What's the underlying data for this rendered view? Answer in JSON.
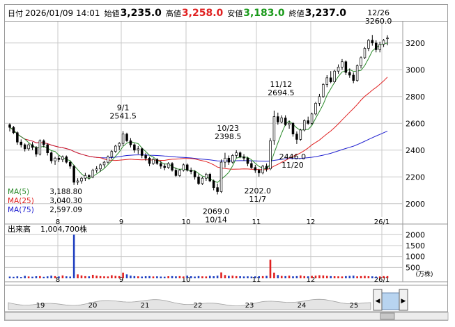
{
  "header": {
    "date_label": "日付",
    "datetime": "2026/01/09 14:01",
    "open_label": "始値",
    "open": "3,235.0",
    "high_label": "高値",
    "high": "3,258.0",
    "low_label": "安値",
    "low": "3,183.0",
    "close_label": "終値",
    "close": "3,237.0"
  },
  "colors": {
    "up": "#ffffff",
    "down": "#000000",
    "ma5": "#2a8a2a",
    "ma25": "#e02020",
    "ma75": "#2020d0",
    "vol_red": "#e02020",
    "vol_blue": "#2040c0",
    "grid": "#c8c8c8",
    "high_text": "#e02020",
    "low_text": "#1a9a1a"
  },
  "chart_data": [
    {
      "type": "candlestick",
      "x_ticks": [
        "8",
        "9",
        "10",
        "11",
        "12",
        "26/1"
      ],
      "y_ticks": [
        2000,
        2200,
        2400,
        2600,
        2800,
        3000,
        3200
      ],
      "ylim": [
        1900,
        3360
      ],
      "legend": [
        {
          "label": "MA(5)",
          "value": "3,188.80"
        },
        {
          "label": "MA(25)",
          "value": "3,040.30"
        },
        {
          "label": "MA(75)",
          "value": "2,597.09"
        }
      ],
      "annotations": [
        {
          "date": "9/1",
          "value": "2541.5",
          "kind": "high"
        },
        {
          "date": "10/14",
          "value": "2069.0",
          "kind": "low"
        },
        {
          "date": "10/23",
          "value": "2398.5",
          "kind": "high"
        },
        {
          "date": "11/12",
          "value": "2694.5",
          "kind": "high"
        },
        {
          "date": "11/7",
          "value": "2202.0",
          "kind": "low"
        },
        {
          "date": "11/20",
          "value": "2446.0",
          "kind": "low"
        },
        {
          "date": "12/26",
          "value": "3260.0",
          "kind": "high"
        }
      ],
      "candles": [
        [
          2590,
          2600,
          2540,
          2570
        ],
        [
          2570,
          2580,
          2520,
          2530
        ],
        [
          2530,
          2540,
          2440,
          2460
        ],
        [
          2460,
          2480,
          2420,
          2440
        ],
        [
          2440,
          2450,
          2390,
          2410
        ],
        [
          2410,
          2450,
          2395,
          2440
        ],
        [
          2440,
          2460,
          2400,
          2420
        ],
        [
          2420,
          2430,
          2350,
          2370
        ],
        [
          2370,
          2480,
          2360,
          2470
        ],
        [
          2470,
          2480,
          2420,
          2440
        ],
        [
          2440,
          2450,
          2360,
          2380
        ],
        [
          2380,
          2390,
          2300,
          2320
        ],
        [
          2320,
          2350,
          2290,
          2340
        ],
        [
          2340,
          2360,
          2310,
          2330
        ],
        [
          2330,
          2360,
          2310,
          2350
        ],
        [
          2350,
          2360,
          2300,
          2310
        ],
        [
          2310,
          2320,
          2260,
          2280
        ],
        [
          2280,
          2290,
          2140,
          2160
        ],
        [
          2160,
          2190,
          2140,
          2170
        ],
        [
          2170,
          2200,
          2150,
          2190
        ],
        [
          2190,
          2230,
          2170,
          2210
        ],
        [
          2210,
          2220,
          2180,
          2200
        ],
        [
          2200,
          2260,
          2190,
          2250
        ],
        [
          2250,
          2280,
          2230,
          2260
        ],
        [
          2260,
          2300,
          2240,
          2290
        ],
        [
          2290,
          2320,
          2270,
          2310
        ],
        [
          2310,
          2360,
          2300,
          2350
        ],
        [
          2350,
          2400,
          2330,
          2390
        ],
        [
          2390,
          2440,
          2380,
          2430
        ],
        [
          2430,
          2460,
          2400,
          2450
        ],
        [
          2450,
          2542,
          2430,
          2520
        ],
        [
          2520,
          2530,
          2460,
          2470
        ],
        [
          2470,
          2490,
          2420,
          2440
        ],
        [
          2440,
          2450,
          2380,
          2400
        ],
        [
          2400,
          2430,
          2370,
          2410
        ],
        [
          2410,
          2420,
          2340,
          2360
        ],
        [
          2360,
          2380,
          2320,
          2340
        ],
        [
          2340,
          2350,
          2280,
          2300
        ],
        [
          2300,
          2340,
          2290,
          2330
        ],
        [
          2330,
          2340,
          2290,
          2300
        ],
        [
          2300,
          2320,
          2260,
          2280
        ],
        [
          2280,
          2300,
          2250,
          2270
        ],
        [
          2270,
          2310,
          2260,
          2300
        ],
        [
          2300,
          2310,
          2240,
          2250
        ],
        [
          2250,
          2270,
          2200,
          2210
        ],
        [
          2210,
          2260,
          2200,
          2250
        ],
        [
          2250,
          2300,
          2240,
          2290
        ],
        [
          2290,
          2300,
          2240,
          2250
        ],
        [
          2250,
          2270,
          2220,
          2240
        ],
        [
          2240,
          2250,
          2180,
          2200
        ],
        [
          2200,
          2220,
          2140,
          2150
        ],
        [
          2150,
          2200,
          2140,
          2190
        ],
        [
          2190,
          2230,
          2170,
          2220
        ],
        [
          2220,
          2230,
          2160,
          2170
        ],
        [
          2170,
          2180,
          2100,
          2120
        ],
        [
          2120,
          2150,
          2069,
          2090
        ],
        [
          2090,
          2330,
          2080,
          2310
        ],
        [
          2310,
          2380,
          2270,
          2340
        ],
        [
          2340,
          2360,
          2290,
          2310
        ],
        [
          2310,
          2370,
          2300,
          2360
        ],
        [
          2360,
          2399,
          2340,
          2380
        ],
        [
          2380,
          2390,
          2340,
          2350
        ],
        [
          2350,
          2370,
          2320,
          2340
        ],
        [
          2340,
          2350,
          2280,
          2300
        ],
        [
          2300,
          2320,
          2260,
          2270
        ],
        [
          2270,
          2290,
          2230,
          2250
        ],
        [
          2250,
          2260,
          2202,
          2230
        ],
        [
          2230,
          2290,
          2220,
          2280
        ],
        [
          2280,
          2300,
          2240,
          2260
        ],
        [
          2260,
          2490,
          2250,
          2470
        ],
        [
          2470,
          2695,
          2440,
          2650
        ],
        [
          2650,
          2680,
          2590,
          2610
        ],
        [
          2610,
          2660,
          2600,
          2640
        ],
        [
          2640,
          2660,
          2580,
          2590
        ],
        [
          2590,
          2620,
          2560,
          2600
        ],
        [
          2600,
          2610,
          2500,
          2520
        ],
        [
          2520,
          2540,
          2446,
          2480
        ],
        [
          2480,
          2560,
          2470,
          2550
        ],
        [
          2550,
          2630,
          2540,
          2620
        ],
        [
          2620,
          2650,
          2590,
          2600
        ],
        [
          2600,
          2680,
          2590,
          2670
        ],
        [
          2670,
          2760,
          2660,
          2750
        ],
        [
          2750,
          2820,
          2730,
          2800
        ],
        [
          2800,
          2900,
          2790,
          2890
        ],
        [
          2890,
          2960,
          2870,
          2940
        ],
        [
          2940,
          2990,
          2900,
          2910
        ],
        [
          2910,
          3000,
          2900,
          2990
        ],
        [
          2990,
          3040,
          2970,
          3020
        ],
        [
          3020,
          3080,
          3000,
          3060
        ],
        [
          3060,
          3070,
          2960,
          2980
        ],
        [
          2980,
          3010,
          2940,
          2960
        ],
        [
          2960,
          2980,
          2900,
          2920
        ],
        [
          2920,
          3040,
          2910,
          3030
        ],
        [
          3030,
          3100,
          3010,
          3090
        ],
        [
          3090,
          3170,
          3080,
          3160
        ],
        [
          3160,
          3230,
          3140,
          3220
        ],
        [
          3220,
          3260,
          3180,
          3200
        ],
        [
          3200,
          3220,
          3130,
          3150
        ],
        [
          3150,
          3210,
          3130,
          3190
        ],
        [
          3190,
          3230,
          3170,
          3220
        ],
        [
          3235,
          3258,
          3183,
          3237
        ]
      ]
    },
    {
      "type": "bar",
      "title": "出来高",
      "latest": "1,004,700株",
      "unit": "(万株)",
      "y_ticks": [
        500,
        1000,
        1500,
        2000
      ],
      "ylim": [
        0,
        2200
      ],
      "values": [
        80,
        70,
        90,
        60,
        110,
        85,
        75,
        95,
        100,
        70,
        90,
        120,
        100,
        85,
        130,
        90,
        80,
        2000,
        180,
        130,
        100,
        90,
        160,
        120,
        100,
        90,
        85,
        140,
        110,
        100,
        260,
        180,
        120,
        100,
        90,
        80,
        95,
        100,
        85,
        90,
        80,
        75,
        95,
        100,
        90,
        100,
        85,
        120,
        95,
        80,
        100,
        90,
        85,
        110,
        95,
        120,
        270,
        150,
        110,
        120,
        100,
        95,
        85,
        90,
        80,
        90,
        95,
        100,
        110,
        850,
        260,
        150,
        110,
        100,
        120,
        90,
        100,
        130,
        100,
        90,
        110,
        120,
        140,
        130,
        110,
        100,
        95,
        90,
        85,
        100,
        110,
        120,
        90,
        100,
        110,
        95,
        90,
        80,
        85,
        100,
        100
      ]
    }
  ],
  "navigator": {
    "labels": [
      "19",
      "20",
      "21",
      "22",
      "23",
      "24",
      "25"
    ],
    "left_arrow": "◀",
    "right_arrow": "▶"
  }
}
